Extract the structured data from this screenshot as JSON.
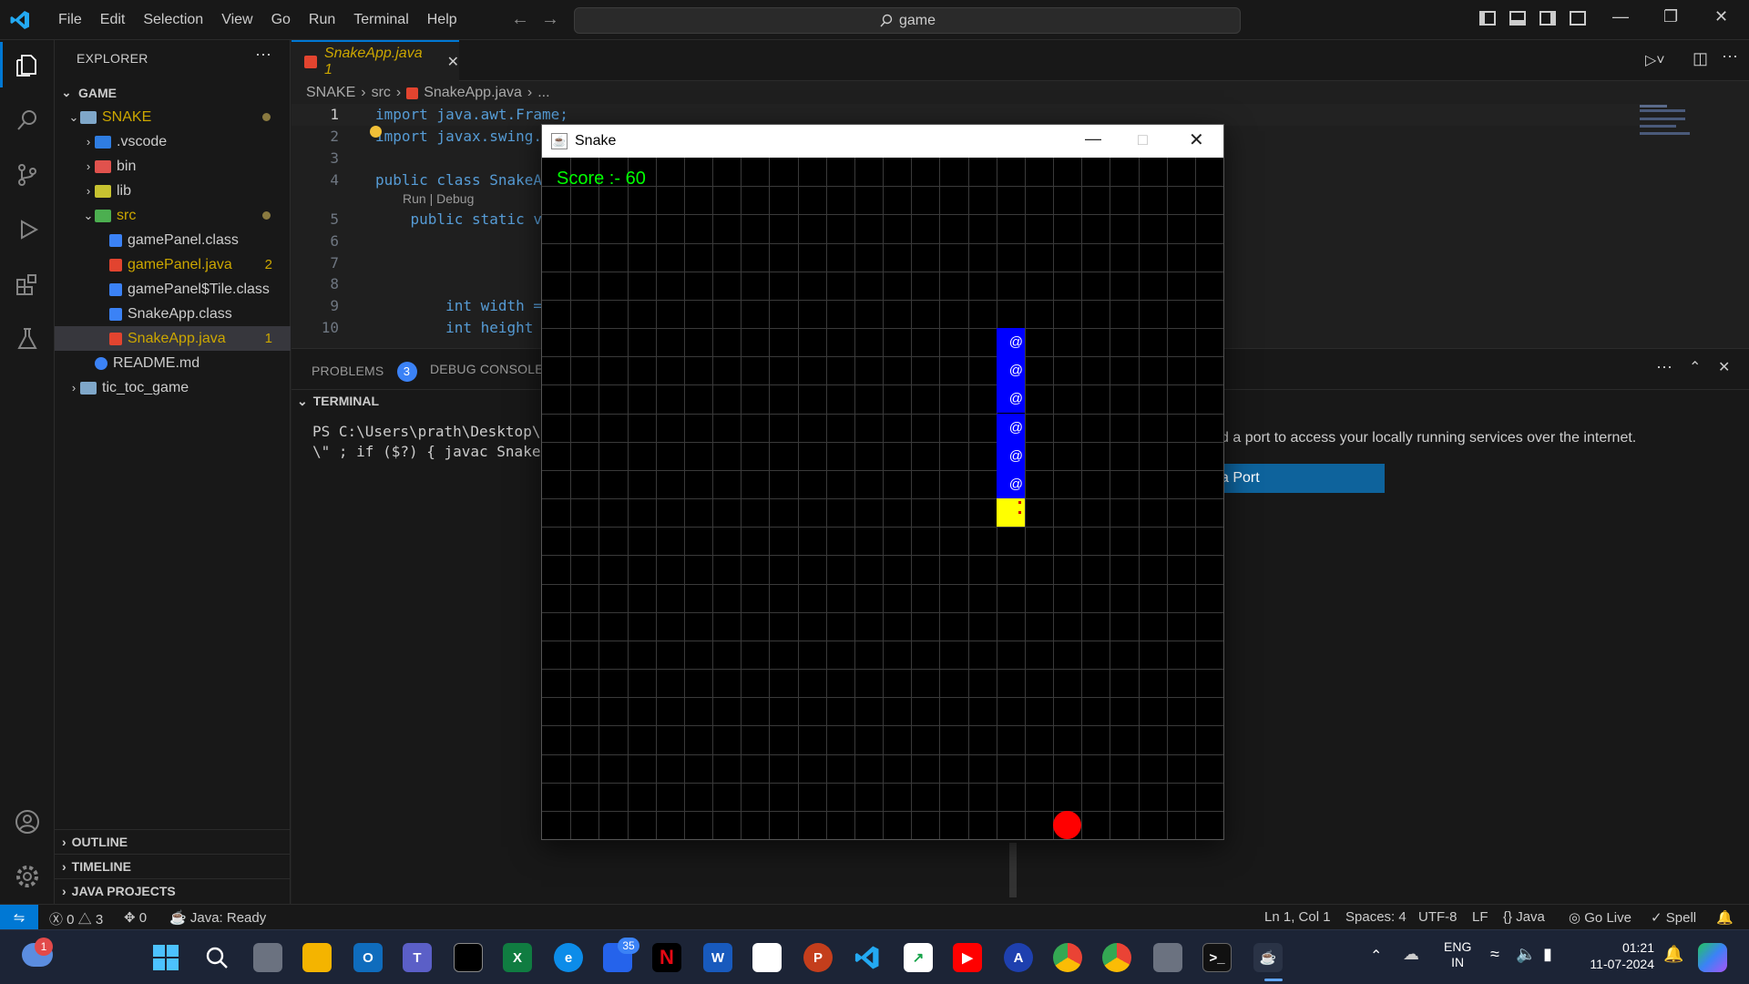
{
  "titlebar": {
    "menu": [
      "File",
      "Edit",
      "Selection",
      "View",
      "Go",
      "Run",
      "Terminal",
      "Help"
    ],
    "search": "game"
  },
  "explorer": {
    "title": "EXPLORER",
    "workspace": "GAME",
    "tree": [
      {
        "name": "SNAKE",
        "type": "folder-open",
        "indent": 1
      },
      {
        "name": ".vscode",
        "type": "folder",
        "indent": 2
      },
      {
        "name": "bin",
        "type": "folder",
        "indent": 2
      },
      {
        "name": "lib",
        "type": "folder",
        "indent": 2
      },
      {
        "name": "src",
        "type": "folder-open",
        "indent": 2
      },
      {
        "name": "gamePanel.class",
        "type": "file",
        "indent": 3
      },
      {
        "name": "gamePanel.java",
        "type": "file",
        "indent": 3,
        "count": "2"
      },
      {
        "name": "gamePanel$Tile.class",
        "type": "file",
        "indent": 3
      },
      {
        "name": "SnakeApp.class",
        "type": "file",
        "indent": 3
      },
      {
        "name": "SnakeApp.java",
        "type": "file",
        "indent": 3,
        "count": "1"
      },
      {
        "name": "README.md",
        "type": "file",
        "indent": 2
      },
      {
        "name": "tic_toc_game",
        "type": "folder",
        "indent": 1
      }
    ],
    "sections": [
      "OUTLINE",
      "TIMELINE",
      "JAVA PROJECTS"
    ]
  },
  "editor": {
    "tab_label": "SnakeApp.java 1",
    "breadcrumb": [
      "SNAKE",
      "src",
      "SnakeApp.java",
      "..."
    ],
    "codelens": "Run | Debug",
    "lines": [
      {
        "n": "1",
        "code": "import java.awt.Frame;"
      },
      {
        "n": "2",
        "code": "import javax.swing.*;"
      },
      {
        "n": "3",
        "code": ""
      },
      {
        "n": "4",
        "code": "public class SnakeAp"
      },
      {
        "n": "5",
        "code": "    public static vo"
      },
      {
        "n": "6",
        "code": ""
      },
      {
        "n": "7",
        "code": ""
      },
      {
        "n": "8",
        "code": ""
      },
      {
        "n": "9",
        "code": "        int width = "
      },
      {
        "n": "10",
        "code": "        int height ="
      }
    ]
  },
  "panel": {
    "problems_label": "PROBLEMS",
    "problems_count": "3",
    "debug_label": "DEBUG CONSOLE",
    "terminal_label": "TERMINAL",
    "terminal_line1": "PS C:\\Users\\prath\\Desktop\\ga",
    "terminal_line2": "\\\" ; if ($?) { javac SnakeAp",
    "port_message": "d a port to access your locally running services over the internet.",
    "port_button": "a Port"
  },
  "snake_window": {
    "title": "Snake",
    "score": "Score :- 60",
    "grid_cells": 24,
    "snake_column": 16,
    "snake_body_rows": [
      6,
      7,
      8,
      9,
      10,
      11
    ],
    "snake_head_row": 12,
    "food": {
      "col": 18,
      "row": 23
    },
    "body_glyph": "@",
    "colors": {
      "background": "#000000",
      "grid": "#3a3a3a",
      "body": "#0000ff",
      "head": "#ffff00",
      "food": "#ff0000",
      "score": "#00ff00"
    }
  },
  "statusbar": {
    "errors": "0",
    "warnings": "3",
    "ports": "0",
    "java_status": "Java: Ready",
    "position": "Ln 1, Col 1",
    "spaces": "Spaces: 4",
    "encoding": "UTF-8",
    "eol": "LF",
    "language": "Java",
    "golive": "Go Live",
    "spell": "Spell"
  },
  "taskbar": {
    "lang_line1": "ENG",
    "lang_line2": "IN",
    "time": "01:21",
    "date": "11-07-2024",
    "notification_badge": "1",
    "store_badge": "35"
  }
}
